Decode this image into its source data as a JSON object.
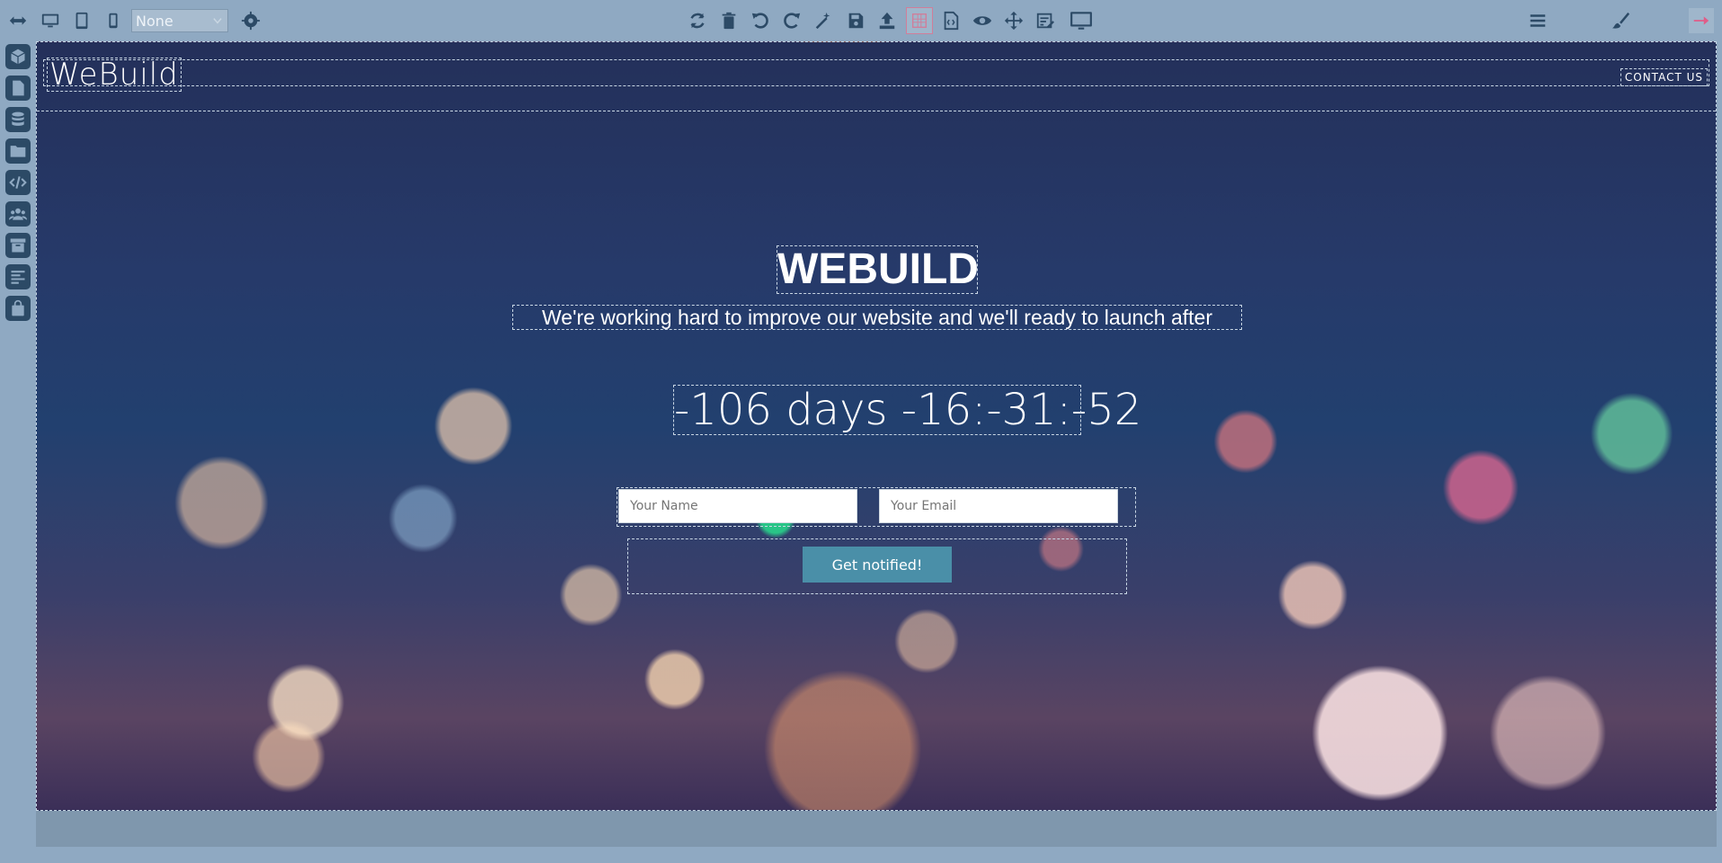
{
  "toolbar": {
    "device_select_value": "None",
    "colors": {
      "background": "#8fa9c2",
      "icon": "#2c4a66",
      "active_outline": "#d07e9a",
      "exit_accent": "#e05c88"
    }
  },
  "page": {
    "brand": "WeBuild",
    "contact_link": "CONTACT US",
    "hero_title": "WEBUILD",
    "hero_subtitle": "We're working hard to improve our website and we'll ready to launch after",
    "countdown": "-106 days -16:-31:-52",
    "form": {
      "name_placeholder": "Your Name",
      "email_placeholder": "Your Email",
      "button_label": "Get notified!"
    },
    "colors": {
      "button": "#4a8fa8",
      "text": "#ffffff"
    }
  }
}
